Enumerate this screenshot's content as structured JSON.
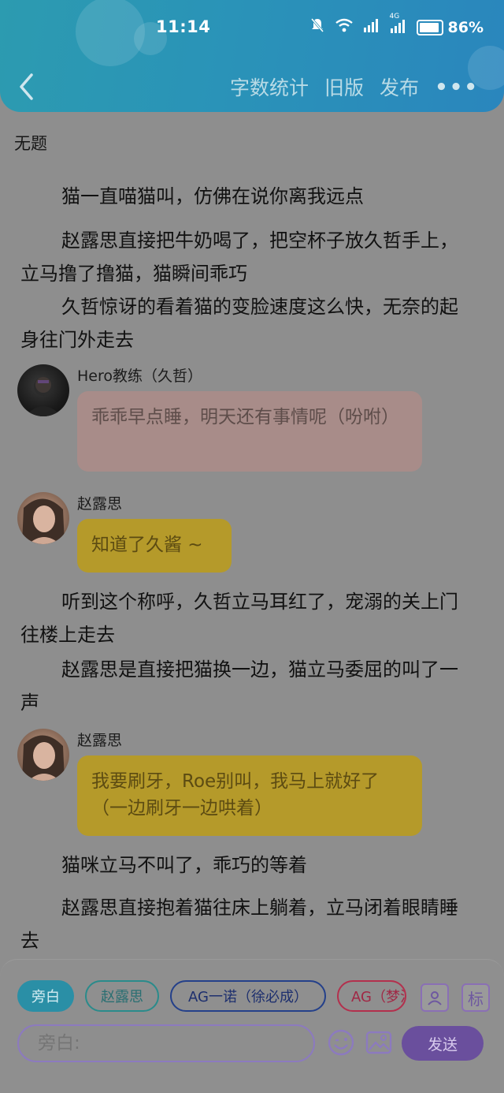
{
  "status_bar": {
    "time": "11:14",
    "battery": "86%",
    "network": "4G"
  },
  "header": {
    "word_count": "字数统计",
    "old_version": "旧版",
    "publish": "发布",
    "more": "•••"
  },
  "doc": {
    "title": "无题",
    "paragraphs": [
      "猫一直喵猫叫，仿佛在说你离我远点",
      "赵露思直接把牛奶喝了，把空杯子放久哲手上，立马撸了撸猫，猫瞬间乖巧",
      "久哲惊讶的看着猫的变脸速度这么快，无奈的起身往门外走去",
      "听到这个称呼，久哲立马耳红了，宠溺的关上门往楼上走去",
      "赵露思是直接把猫换一边，猫立马委屈的叫了一声",
      "猫咪立马不叫了，乖巧的等着",
      "赵露思直接抱着猫往床上躺着，立马闭着眼睛睡去"
    ],
    "messages": [
      {
        "speaker": "Hero教练（久哲）",
        "text": "乖乖早点睡，明天还有事情呢（吩咐）"
      },
      {
        "speaker": "赵露思",
        "text": "知道了久酱 ~"
      },
      {
        "speaker": "赵露思",
        "text": "我要刷牙，Roe别叫，我马上就好了（一边刷牙一边哄着）"
      }
    ]
  },
  "bottom": {
    "chips": [
      "旁白",
      "赵露思",
      "AG一诺（徐必成）",
      "AG（梦泪）"
    ],
    "tag_label": "标",
    "input_placeholder": "旁白:",
    "send_label": "发送"
  },
  "colors": {
    "header_bg": "#2a93b8",
    "overlay_bg": "#8e8e8e",
    "bubble_pink": "#a88c89",
    "bubble_yellow": "#b59a2a",
    "send_bg": "#6a4f9d"
  }
}
